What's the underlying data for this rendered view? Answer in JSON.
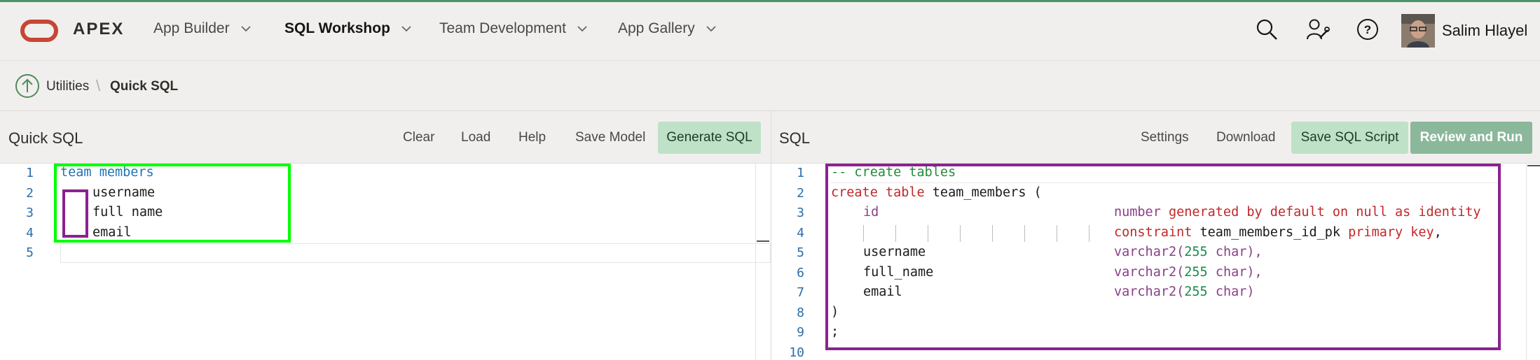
{
  "header": {
    "brand": "APEX",
    "nav": [
      {
        "label": "App Builder"
      },
      {
        "label": "SQL Workshop"
      },
      {
        "label": "Team Development"
      },
      {
        "label": "App Gallery"
      }
    ],
    "user_name": "Salim Hlayel"
  },
  "breadcrumb": {
    "parent": "Utilities",
    "current": "Quick SQL"
  },
  "left_panel": {
    "title": "Quick SQL",
    "buttons": {
      "clear": "Clear",
      "load": "Load",
      "help": "Help",
      "save_model": "Save Model",
      "generate": "Generate SQL"
    },
    "line_numbers": [
      "1",
      "2",
      "3",
      "4",
      "5"
    ],
    "lines": [
      "team members",
      "username",
      "full name",
      "email",
      ""
    ]
  },
  "right_panel": {
    "title": "SQL",
    "buttons": {
      "settings": "Settings",
      "download": "Download",
      "save_script": "Save SQL Script",
      "review_run": "Review and Run"
    },
    "line_numbers": [
      "1",
      "2",
      "3",
      "4",
      "5",
      "6",
      "7",
      "8",
      "9",
      "10"
    ],
    "code": {
      "l1": "-- create tables",
      "l2_kw": "create table",
      "l2_name": "team_members (",
      "l3_col": "id",
      "l3_type": "number",
      "l3_rest": "generated by default on null as identity",
      "l4_kw1": "constraint",
      "l4_name": "team_members_id_pk",
      "l4_kw2": "primary key",
      "l4_end": ",",
      "l5_col": "username",
      "l6_col": "full_name",
      "l7_col": "email",
      "vc_type": "varchar2(",
      "vc_num": "255",
      "vc_unit": "char",
      "vc_close": ")",
      "vc_close_comma": "),",
      "l8": ")",
      "l9": ";"
    }
  },
  "colors": {
    "accent_green": "#00ff00",
    "highlight_purple": "#8b2291",
    "generate_bg": "#bfe1c8",
    "review_bg": "#8bb89a"
  }
}
